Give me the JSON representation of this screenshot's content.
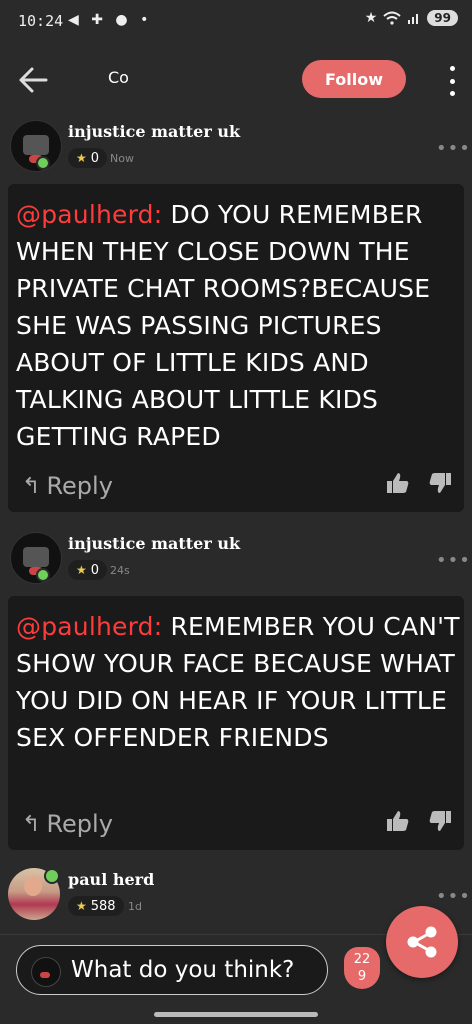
{
  "status_bar": {
    "time": "10:24",
    "left_icons": "◀ ✚ ● •",
    "battery": "99"
  },
  "header": {
    "title": "Co",
    "follow_label": "Follow"
  },
  "comments": [
    {
      "username": "injustice matter uk",
      "reputation": "0",
      "time": "Now",
      "mention": "@paulherd:",
      "text": " DO YOU REMEMBER WHEN THEY CLOSE DOWN THE PRIVATE CHAT ROOMS?BECAUSE SHE WAS PASSING PICTURES ABOUT OF LITTLE KIDS AND TALKING ABOUT LITTLE KIDS GETTING RAPED",
      "reply_label": "Reply"
    },
    {
      "username": "injustice matter uk",
      "reputation": "0",
      "time": "24s",
      "mention": "@paulherd:",
      "text": " REMEMBER YOU CAN'T SHOW YOUR FACE BECAUSE WHAT YOU DID ON HEAR IF YOUR LITTLE SEX OFFENDER FRIENDS",
      "reply_label": "Reply"
    },
    {
      "username": "paul herd",
      "reputation": "588",
      "time": "1d"
    }
  ],
  "composer": {
    "placeholder": "What do you think?",
    "count_line1": "22",
    "count_line2": "9"
  },
  "colors": {
    "accent": "#e66a6a",
    "mention": "#ff3b3b",
    "star": "#f2c94c",
    "online": "#6ecf5a"
  }
}
